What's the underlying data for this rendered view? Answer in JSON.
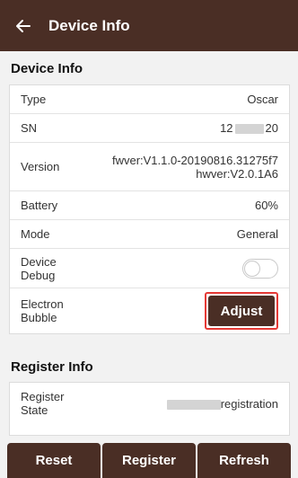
{
  "header": {
    "title": "Device Info",
    "back_icon": "arrow-left-icon"
  },
  "device_info": {
    "section_title": "Device Info",
    "rows": {
      "type": {
        "label": "Type",
        "value": "Oscar"
      },
      "sn": {
        "label": "SN",
        "value_prefix": "12",
        "value_suffix": "20"
      },
      "version": {
        "label": "Version",
        "value_line1": "fwver:V1.1.0-20190816.31275f7",
        "value_line2": "hwver:V2.0.1A6"
      },
      "battery": {
        "label": "Battery",
        "value": "60%"
      },
      "mode": {
        "label": "Mode",
        "value": "General"
      },
      "debug": {
        "label_line1": "Device",
        "label_line2": "Debug",
        "enabled": false
      },
      "bubble": {
        "label_line1": "Electron",
        "label_line2": "Bubble",
        "button": "Adjust"
      }
    }
  },
  "register_info": {
    "section_title": "Register Info",
    "rows": {
      "state": {
        "label_line1": "Register",
        "label_line2": "State",
        "value_suffix": "registration"
      }
    }
  },
  "bottom_bar": {
    "reset": "Reset",
    "register": "Register",
    "refresh": "Refresh"
  },
  "colors": {
    "primary": "#4a2e25",
    "highlight": "#e53935",
    "background": "#f2f2f2"
  }
}
